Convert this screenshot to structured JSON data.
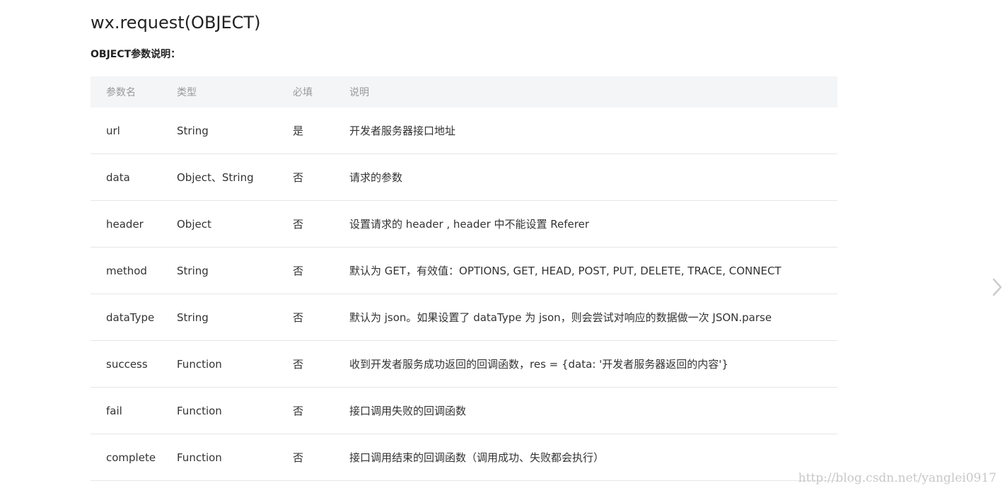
{
  "doc": {
    "title": "wx.request(OBJECT)",
    "subtitle": "OBJECT参数说明："
  },
  "table": {
    "headers": [
      "参数名",
      "类型",
      "必填",
      "说明"
    ],
    "rows": [
      [
        "url",
        "String",
        "是",
        "开发者服务器接口地址"
      ],
      [
        "data",
        "Object、String",
        "否",
        "请求的参数"
      ],
      [
        "header",
        "Object",
        "否",
        "设置请求的 header , header 中不能设置 Referer"
      ],
      [
        "method",
        "String",
        "否",
        "默认为 GET，有效值：OPTIONS, GET, HEAD, POST, PUT, DELETE, TRACE, CONNECT"
      ],
      [
        "dataType",
        "String",
        "否",
        "默认为 json。如果设置了 dataType 为 json，则会尝试对响应的数据做一次 JSON.parse"
      ],
      [
        "success",
        "Function",
        "否",
        "收到开发者服务成功返回的回调函数，res = {data: '开发者服务器返回的内容'}"
      ],
      [
        "fail",
        "Function",
        "否",
        "接口调用失败的回调函数"
      ],
      [
        "complete",
        "Function",
        "否",
        "接口调用结束的回调函数（调用成功、失败都会执行）"
      ]
    ]
  },
  "navigation": {
    "next_icon": "chevron-right-icon"
  },
  "watermark": "http://blog.csdn.net/yanglei0917",
  "colors": {
    "header_bg": "#f4f5f7",
    "header_text": "#999999",
    "row_border": "#e6e6e6",
    "text": "#333333"
  }
}
